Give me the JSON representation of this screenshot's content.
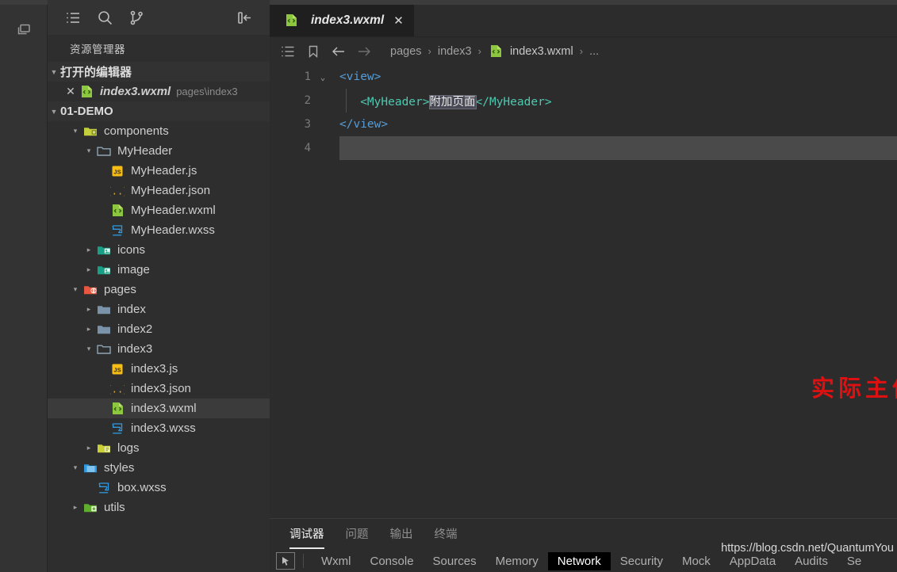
{
  "activity_bar": {
    "items": [
      {
        "name": "windows-restore-icon",
        "label": ""
      }
    ]
  },
  "sidebar": {
    "toolbar": [
      {
        "icon": "list-icon",
        "label": ""
      },
      {
        "icon": "search-icon",
        "label": ""
      },
      {
        "icon": "source-control-icon",
        "label": ""
      },
      {
        "icon": "collapse-sidebar-icon",
        "label": ""
      }
    ],
    "title": "资源管理器",
    "open_editors": {
      "label": "打开的编辑器",
      "expanded": true,
      "items": [
        {
          "name": "index3.wxml",
          "path": "pages\\index3",
          "icon": "wxml-file-icon",
          "close": "✕"
        }
      ]
    },
    "project": {
      "label": "01-DEMO",
      "expanded": true
    },
    "tree": [
      {
        "depth": 1,
        "twisty": "▾",
        "icon": "folder-components-icon",
        "label": "components",
        "type": "folder"
      },
      {
        "depth": 2,
        "twisty": "▾",
        "icon": "folder-open-icon",
        "label": "MyHeader",
        "type": "folder"
      },
      {
        "depth": 3,
        "twisty": "",
        "icon": "js-file-icon",
        "label": "MyHeader.js",
        "type": "file"
      },
      {
        "depth": 3,
        "twisty": "",
        "icon": "json-file-icon",
        "label": "MyHeader.json",
        "type": "file"
      },
      {
        "depth": 3,
        "twisty": "",
        "icon": "wxml-file-icon",
        "label": "MyHeader.wxml",
        "type": "file"
      },
      {
        "depth": 3,
        "twisty": "",
        "icon": "wxss-file-icon",
        "label": "MyHeader.wxss",
        "type": "file"
      },
      {
        "depth": 2,
        "twisty": "▸",
        "icon": "folder-images-icon",
        "label": "icons",
        "type": "folder"
      },
      {
        "depth": 2,
        "twisty": "▸",
        "icon": "folder-images-icon",
        "label": "image",
        "type": "folder"
      },
      {
        "depth": 1,
        "twisty": "▾",
        "icon": "folder-pages-icon",
        "label": "pages",
        "type": "folder"
      },
      {
        "depth": 2,
        "twisty": "▸",
        "icon": "folder-plain-icon",
        "label": "index",
        "type": "folder"
      },
      {
        "depth": 2,
        "twisty": "▸",
        "icon": "folder-plain-icon",
        "label": "index2",
        "type": "folder"
      },
      {
        "depth": 2,
        "twisty": "▾",
        "icon": "folder-open-icon",
        "label": "index3",
        "type": "folder"
      },
      {
        "depth": 3,
        "twisty": "",
        "icon": "js-file-icon",
        "label": "index3.js",
        "type": "file"
      },
      {
        "depth": 3,
        "twisty": "",
        "icon": "json-file-icon",
        "label": "index3.json",
        "type": "file"
      },
      {
        "depth": 3,
        "twisty": "",
        "icon": "wxml-file-icon",
        "label": "index3.wxml",
        "type": "file",
        "selected": true
      },
      {
        "depth": 3,
        "twisty": "",
        "icon": "wxss-file-icon",
        "label": "index3.wxss",
        "type": "file"
      },
      {
        "depth": 2,
        "twisty": "▸",
        "icon": "folder-logs-icon",
        "label": "logs",
        "type": "folder"
      },
      {
        "depth": 1,
        "twisty": "▾",
        "icon": "folder-styles-icon",
        "label": "styles",
        "type": "folder"
      },
      {
        "depth": 2,
        "twisty": "",
        "icon": "wxss-file-icon",
        "label": "box.wxss",
        "type": "file"
      },
      {
        "depth": 1,
        "twisty": "▸",
        "icon": "folder-utils-icon",
        "label": "utils",
        "type": "folder"
      }
    ]
  },
  "editor": {
    "tabs": [
      {
        "label": "index3.wxml",
        "icon": "wxml-file-icon",
        "close": "✕",
        "active": true
      }
    ],
    "breadcrumb_icons": [
      {
        "icon": "outline-list-icon"
      },
      {
        "icon": "bookmark-icon"
      },
      {
        "icon": "arrow-back-icon"
      },
      {
        "icon": "arrow-forward-icon"
      }
    ],
    "breadcrumbs": [
      {
        "label": "pages",
        "icon": ""
      },
      {
        "label": "index3",
        "icon": ""
      },
      {
        "label": "index3.wxml",
        "icon": "wxml-file-icon"
      },
      {
        "label": "...",
        "icon": ""
      }
    ],
    "breadcrumb_separator": "›",
    "lines": [
      {
        "num": "1",
        "fold": "⌄",
        "segments": [
          {
            "t": "<view>",
            "cls": "tok-tag"
          }
        ]
      },
      {
        "num": "2",
        "fold": "",
        "indent_guide": true,
        "segments": [
          {
            "t": "   ",
            "cls": "tok-txt"
          },
          {
            "t": "<MyHeader>",
            "cls": "tok-comp"
          },
          {
            "t": "附加页面",
            "cls": "tok-txt sel-box"
          },
          {
            "t": "</MyHeader>",
            "cls": "tok-comp"
          }
        ]
      },
      {
        "num": "3",
        "fold": "",
        "segments": [
          {
            "t": "</view>",
            "cls": "tok-tag"
          }
        ]
      },
      {
        "num": "4",
        "fold": "",
        "active": true,
        "segments": []
      }
    ],
    "annotation": "实际主体显示页面",
    "annotation_color": "#dd1111"
  },
  "panel": {
    "tabs": [
      {
        "label": "调试器",
        "active": true
      },
      {
        "label": "问题",
        "active": false
      },
      {
        "label": "输出",
        "active": false
      },
      {
        "label": "终端",
        "active": false
      }
    ],
    "devtools": {
      "cursor_icon": "inspect-cursor-icon",
      "tabs": [
        {
          "label": "Wxml",
          "active": false
        },
        {
          "label": "Console",
          "active": false
        },
        {
          "label": "Sources",
          "active": false
        },
        {
          "label": "Memory",
          "active": false
        },
        {
          "label": "Network",
          "active": true
        },
        {
          "label": "Security",
          "active": false
        },
        {
          "label": "Mock",
          "active": false
        },
        {
          "label": "AppData",
          "active": false
        },
        {
          "label": "Audits",
          "active": false
        },
        {
          "label": "Se",
          "active": false
        }
      ]
    },
    "watermark": "https://blog.csdn.net/QuantumYou"
  },
  "colors": {
    "accent_red": "#dd1111",
    "tab_active_bg": "#1f1f1f",
    "sidebar_bg": "#2e2e2e",
    "editor_bg": "#2c2c2c",
    "tag_blue": "#569cd6",
    "component_teal": "#4ec9b0"
  }
}
